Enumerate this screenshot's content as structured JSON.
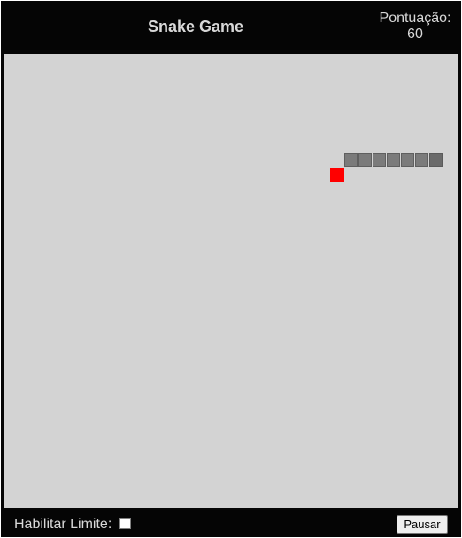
{
  "header": {
    "title": "Snake Game",
    "score_label": "Pontuação:",
    "score_value": "60"
  },
  "game": {
    "grid_cell_count": 32,
    "snake_cells": [
      [
        24,
        7
      ],
      [
        25,
        7
      ],
      [
        26,
        7
      ],
      [
        27,
        7
      ],
      [
        28,
        7
      ],
      [
        29,
        7
      ],
      [
        30,
        7
      ]
    ],
    "snake_head_cell": [
      30,
      7
    ],
    "food_cell": [
      23,
      8
    ],
    "board_color": "#d3d3d3",
    "snake_color": "#7b7b7b",
    "food_color": "#ff0000"
  },
  "footer": {
    "limit_label": "Habilitar Limite:",
    "limit_checked": false,
    "pause_label": "Pausar"
  }
}
